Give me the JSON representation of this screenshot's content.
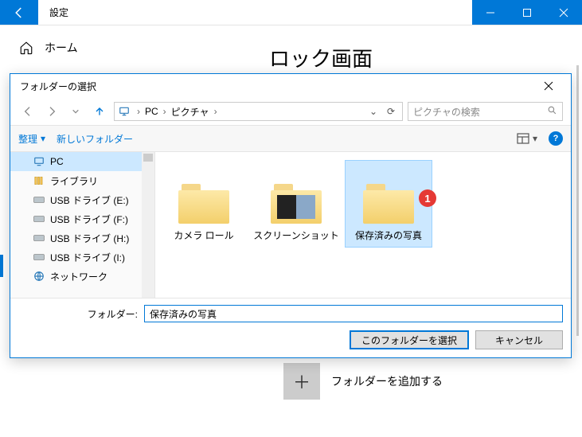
{
  "titlebar": {
    "title": "設定"
  },
  "nav": {
    "home": "ホーム"
  },
  "page": {
    "heading": "ロック画面"
  },
  "add_folder": {
    "label": "フォルダーを追加する",
    "plus": "＋"
  },
  "dialog": {
    "title": "フォルダーの選択",
    "breadcrumb": {
      "0": "PC",
      "1": "ピクチャ"
    },
    "search_placeholder": "ピクチャの検索",
    "toolbar": {
      "organize": "整理",
      "newfolder": "新しいフォルダー"
    },
    "tree": {
      "0": "PC",
      "1": "ライブラリ",
      "2": "USB ドライブ (E:)",
      "3": "USB ドライブ (F:)",
      "4": "USB ドライブ (H:)",
      "5": "USB ドライブ (I:)",
      "6": "ネットワーク"
    },
    "folders": {
      "0": "カメラ ロール",
      "1": "スクリーンショット",
      "2": "保存済みの写真"
    },
    "badge": "1",
    "folder_field_label": "フォルダー:",
    "folder_field_value": "保存済みの写真",
    "btn_select": "このフォルダーを選択",
    "btn_cancel": "キャンセル"
  }
}
